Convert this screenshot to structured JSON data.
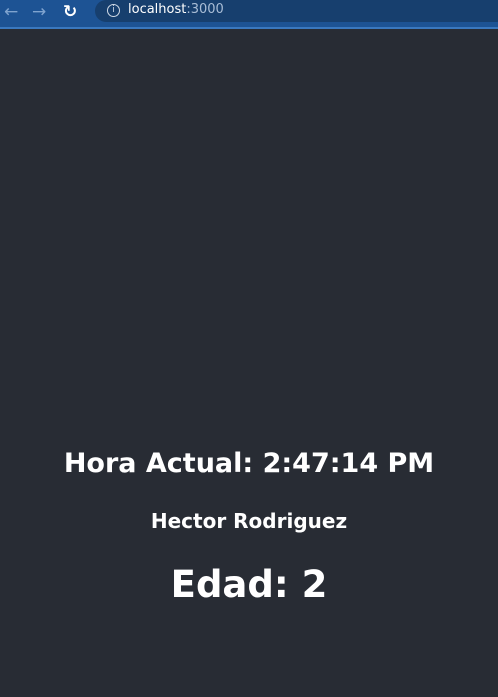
{
  "browser": {
    "url_host": "localhost",
    "url_port": ":3000"
  },
  "app": {
    "time_text": "Hora Actual: 2:47:14 PM",
    "name": "Hector Rodriguez",
    "age_text": "Edad: 2"
  }
}
